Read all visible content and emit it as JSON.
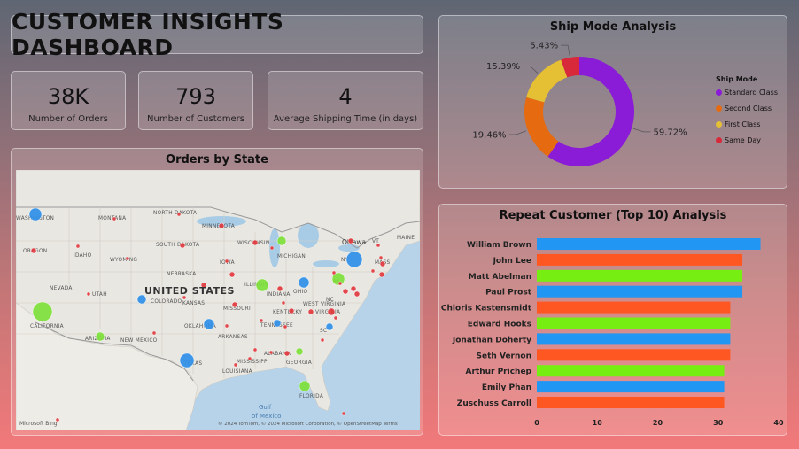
{
  "dashboard": {
    "title": "CUSTOMER INSIGHTS DASHBOARD"
  },
  "kpis": [
    {
      "value": "38K",
      "label": "Number of Orders"
    },
    {
      "value": "793",
      "label": "Number of Customers"
    },
    {
      "value": "4",
      "label": "Average Shipping Time (in days)"
    }
  ],
  "map": {
    "title": "Orders by State",
    "country_label": "UNITED STATES",
    "state_labels": [
      "WASHINGTON",
      "MONTANA",
      "NORTH DAKOTA",
      "MINNESOTA",
      "OREGON",
      "IDAHO",
      "SOUTH DAKOTA",
      "WISCONSIN",
      "MICHIGAN",
      "WYOMING",
      "NEBRASKA",
      "IOWA",
      "NEVADA",
      "UTAH",
      "COLORADO",
      "KANSAS",
      "ILLINOIS",
      "INDIANA",
      "OHIO",
      "MISSOURI",
      "KENTUCKY",
      "WEST VIRGINIA",
      "VIRGINIA",
      "CALIFORNIA",
      "ARIZONA",
      "NEW MEXICO",
      "OKLAHOMA",
      "ARKANSAS",
      "TENNESSEE",
      "NC",
      "SC",
      "TEXAS",
      "MISSISSIPPI",
      "ALABAMA",
      "GEORGIA",
      "LOUISIANA",
      "FLORIDA",
      "NY",
      "PA",
      "MAINE",
      "VT",
      "MASS",
      "Ottawa",
      "Gulf of Mexico"
    ],
    "attribution": "© 2024 TomTom, © 2024 Microsoft Corporation, © OpenStreetMap  Terms",
    "logo": "Microsoft Bing",
    "colors": {
      "land": "#e9e7e2",
      "water": "#b6d3ea",
      "lake": "#a9cce6",
      "red": "#e0393e",
      "blue": "#2f8fe8",
      "green": "#7de03a"
    }
  },
  "ship_mode": {
    "title": "Ship Mode Analysis",
    "legend_title": "Ship Mode",
    "chart_data": {
      "type": "pie",
      "donut": true,
      "title": "Ship Mode Analysis",
      "legend_title": "Ship Mode",
      "categories": [
        "Standard Class",
        "Second Class",
        "First Class",
        "Same Day"
      ],
      "values": [
        59.72,
        19.46,
        15.39,
        5.43
      ],
      "labels": [
        "59.72%",
        "19.46%",
        "15.39%",
        "5.43%"
      ],
      "colors": [
        "#8a1bd6",
        "#e56a10",
        "#e5c035",
        "#d8293a"
      ],
      "legend_position": "right"
    }
  },
  "repeat_customers": {
    "title": "Repeat Customer (Top 10) Analysis",
    "chart_data": {
      "type": "bar",
      "orientation": "horizontal",
      "title": "Repeat Customer (Top 10) Analysis",
      "categories": [
        "William Brown",
        "John Lee",
        "Matt Abelman",
        "Paul Prost",
        "Chloris Kastensmidt",
        "Edward Hooks",
        "Jonathan Doherty",
        "Seth Vernon",
        "Arthur Prichep",
        "Emily Phan",
        "Zuschuss Carroll"
      ],
      "values": [
        37,
        34,
        34,
        34,
        32,
        32,
        32,
        32,
        31,
        31,
        31
      ],
      "colors": [
        "#2196f3",
        "#ff5722",
        "#76ee12",
        "#2196f3",
        "#ff5722",
        "#76ee12",
        "#2196f3",
        "#ff5722",
        "#76ee12",
        "#2196f3",
        "#ff5722"
      ],
      "xlim": [
        0,
        40
      ],
      "xticks": [
        0,
        10,
        20,
        30,
        40
      ],
      "grid": false
    }
  }
}
